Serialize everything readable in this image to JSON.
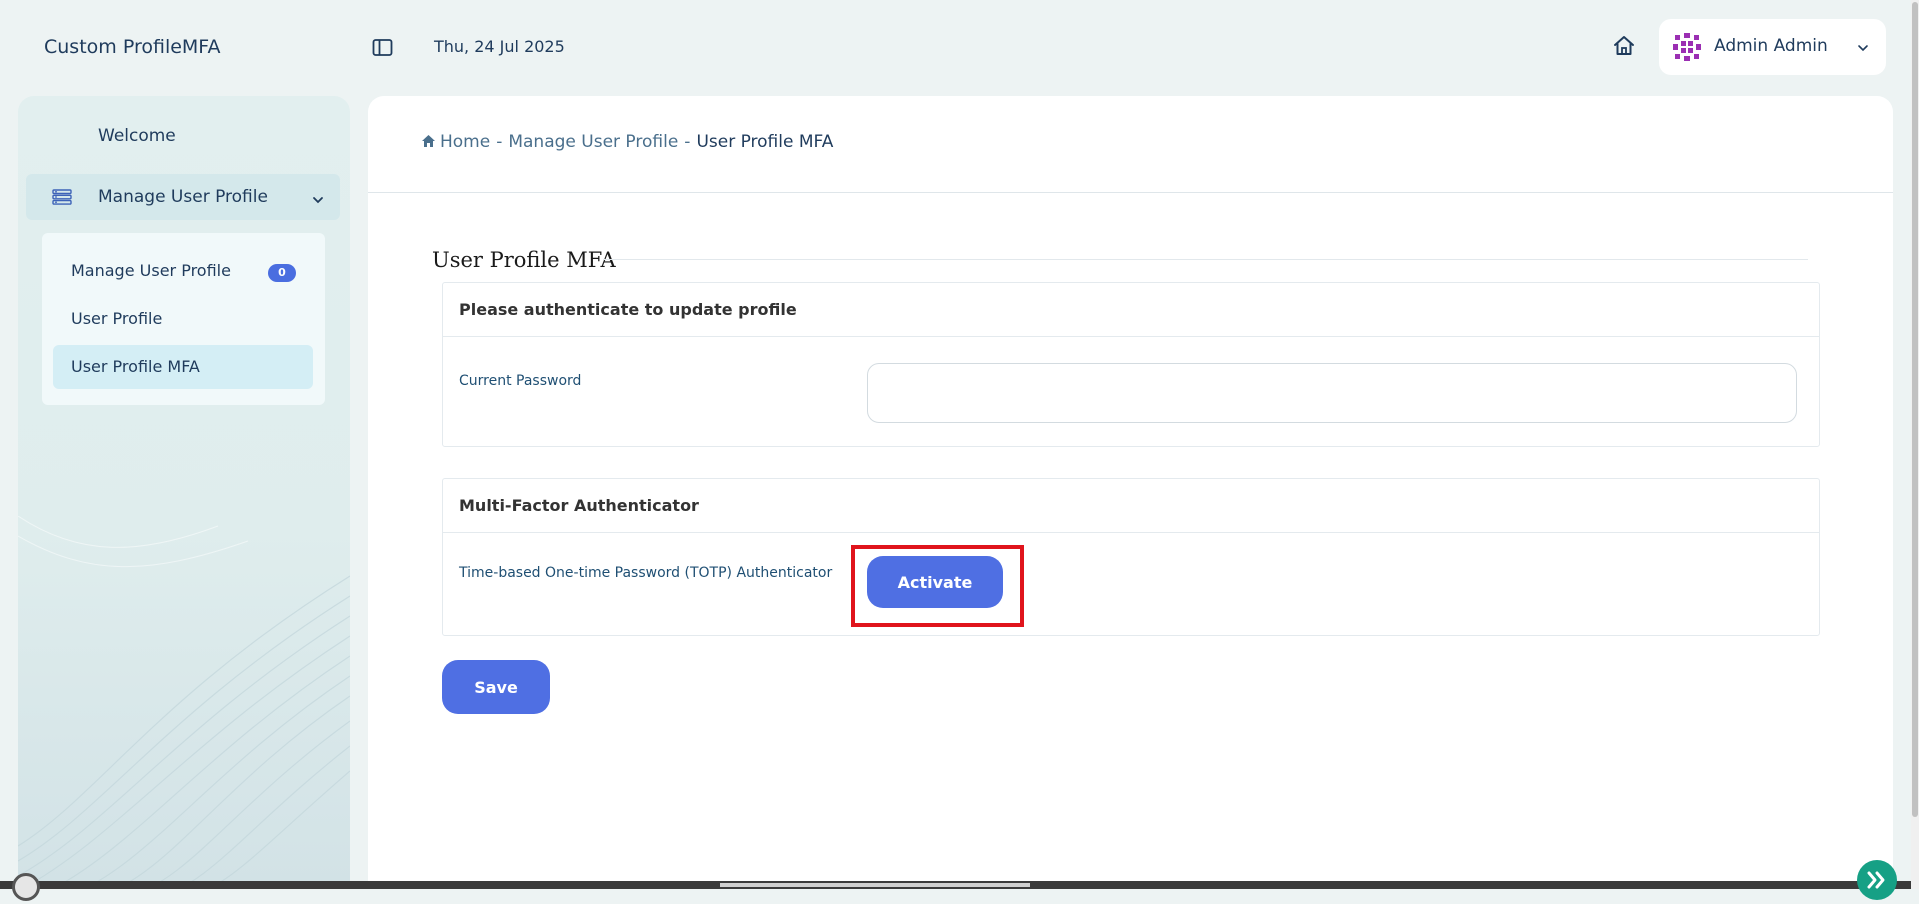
{
  "header": {
    "app_title": "Custom ProfileMFA",
    "date": "Thu, 24 Jul 2025",
    "user_name": "Admin Admin"
  },
  "sidebar": {
    "welcome_label": "Welcome",
    "group_label": "Manage User Profile",
    "items": [
      {
        "label": "Manage User Profile",
        "badge": "0"
      },
      {
        "label": "User Profile"
      },
      {
        "label": "User Profile MFA",
        "active": true
      }
    ]
  },
  "breadcrumb": {
    "home": "Home",
    "parent": "Manage User Profile",
    "current": "User Profile MFA",
    "separator": "-"
  },
  "form": {
    "legend": "User Profile MFA",
    "auth_card": {
      "title": "Please authenticate to update profile",
      "password_label": "Current Password",
      "password_value": ""
    },
    "mfa_card": {
      "title": "Multi-Factor Authenticator",
      "totp_label": "Time-based One-time Password (TOTP) Authenticator",
      "activate_label": "Activate"
    },
    "save_label": "Save"
  },
  "colors": {
    "primary_button": "#4f6fe3",
    "highlight": "#e0141c",
    "badge": "#4a6ee0",
    "fab": "#16a085"
  }
}
